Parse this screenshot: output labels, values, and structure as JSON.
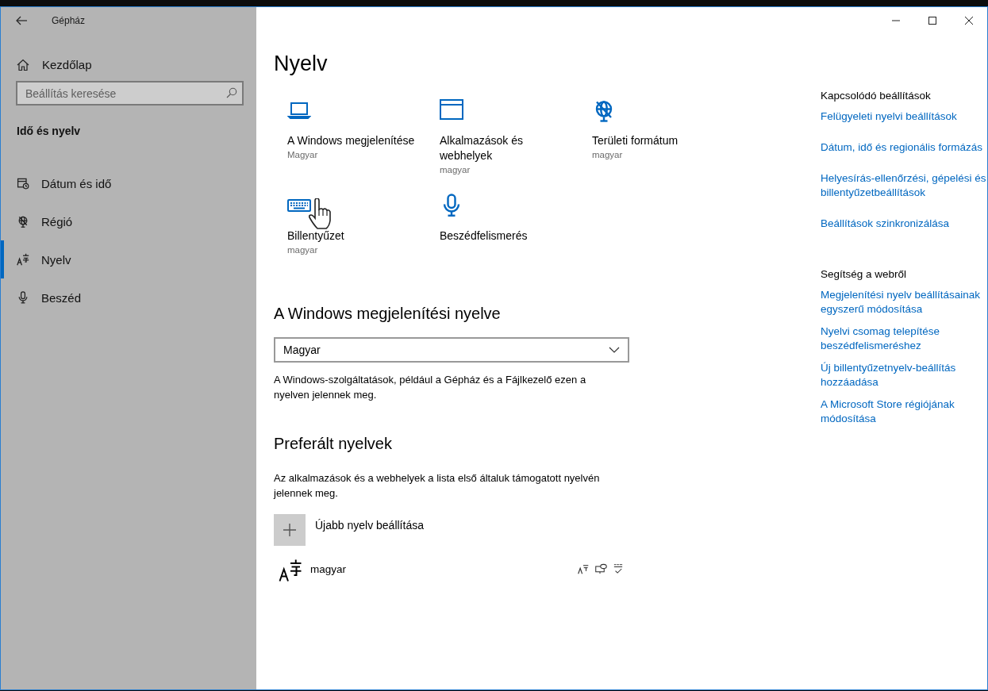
{
  "window": {
    "title": "Gépház"
  },
  "sidebar": {
    "home": "Kezdőlap",
    "search": {
      "placeholder": "Beállítás keresése"
    },
    "section": "Idő és nyelv",
    "items": [
      {
        "kind": "calendar",
        "label": "Dátum és idő",
        "selected": false
      },
      {
        "kind": "globe",
        "label": "Régió",
        "selected": false
      },
      {
        "kind": "language",
        "label": "Nyelv",
        "selected": true
      },
      {
        "kind": "microphone",
        "label": "Beszéd",
        "selected": false
      }
    ]
  },
  "main": {
    "title": "Nyelv",
    "tiles": [
      {
        "kind": "laptop",
        "label": "A Windows megjelenítése",
        "value": "Magyar"
      },
      {
        "kind": "window",
        "label": "Alkalmazások és webhelyek",
        "value": "magyar"
      },
      {
        "kind": "globe",
        "label": "Területi formátum",
        "value": "magyar"
      },
      {
        "kind": "keyboard",
        "label": "Billentyűzet",
        "value": "magyar"
      },
      {
        "kind": "microphone",
        "label": "Beszédfelismerés"
      }
    ],
    "display_language": {
      "heading": "A Windows megjelenítési nyelve",
      "value": "Magyar",
      "description": "A Windows-szolgáltatások, például a Gépház és a Fájlkezelő ezen a nyelven jelennek meg."
    },
    "preferred": {
      "heading": "Preferált nyelvek",
      "description": "Az alkalmazások és a webhelyek a lista első általuk támogatott nyelvén jelennek meg.",
      "add_label": "Újabb nyelv beállítása",
      "languages": [
        {
          "name": "magyar"
        }
      ]
    }
  },
  "related": {
    "heading": "Kapcsolódó beállítások",
    "links": [
      "Felügyeleti nyelvi beállítások",
      "Dátum, idő és regionális formázás",
      "Helyesírás-ellenőrzési, gépelési és billentyűzetbeállítások",
      "Beállítások szinkronizálása"
    ]
  },
  "help": {
    "heading": "Segítség a webről",
    "links": [
      "Megjelenítési nyelv beállításainak egyszerű módosítása",
      "Nyelvi csomag telepítése beszédfelismeréshez",
      "Új billentyűzetnyelv-beállítás hozzáadása",
      "A Microsoft Store régiójának módosítása"
    ]
  }
}
